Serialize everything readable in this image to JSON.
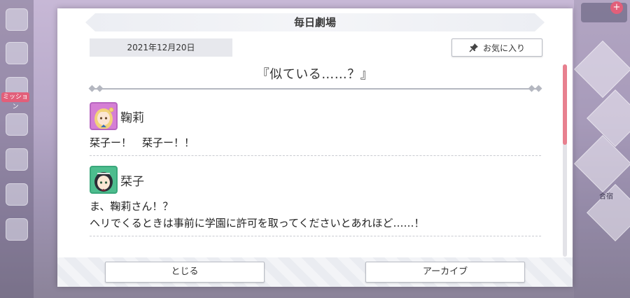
{
  "background": {
    "side_badge": "ミッション",
    "right_label": "合宿"
  },
  "dialog": {
    "title": "毎日劇場",
    "date": "2021年12月20日",
    "favorite_label": "お気に入り",
    "story_title": "『似ている……？』",
    "messages": [
      {
        "speaker": "鞠莉",
        "lines": [
          "栞子ー！　栞子ー！！"
        ]
      },
      {
        "speaker": "栞子",
        "lines": [
          "ま、鞠莉さん！？",
          "ヘリでくるときは事前に学園に許可を取ってくださいとあれほど……！"
        ]
      }
    ],
    "close_label": "とじる",
    "archive_label": "アーカイブ"
  },
  "colors": {
    "accent_scroll": "#e8808f",
    "mari_frame": "#d57fd5",
    "shioriko_frame": "#4dbd8e"
  },
  "scroll_position": 0.0
}
